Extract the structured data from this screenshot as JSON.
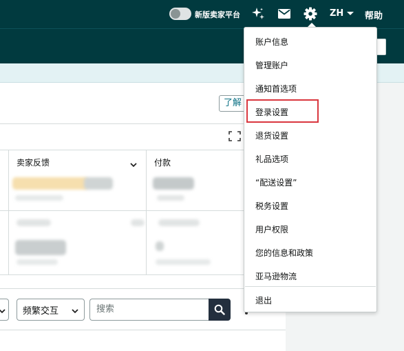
{
  "header": {
    "toggle_label": "新版卖家平台",
    "language": "ZH",
    "help_label": "帮助"
  },
  "content": {
    "learn_more": "了解",
    "columns": [
      "卖家反馈",
      "付款"
    ],
    "filter_label": "频繁交互",
    "search_placeholder": "搜索"
  },
  "settings_menu": {
    "items": [
      "账户信息",
      "管理账户",
      "通知首选项",
      "登录设置",
      "退货设置",
      "礼品选项",
      "“配送设置”",
      "税务设置",
      "用户权限",
      "您的信息和政策",
      "亚马逊物流"
    ],
    "highlighted": "登录设置",
    "logout": "退出"
  },
  "colors": {
    "header_bg": "#013a3f",
    "highlight_border": "#d9363e",
    "link": "#0f7386"
  }
}
